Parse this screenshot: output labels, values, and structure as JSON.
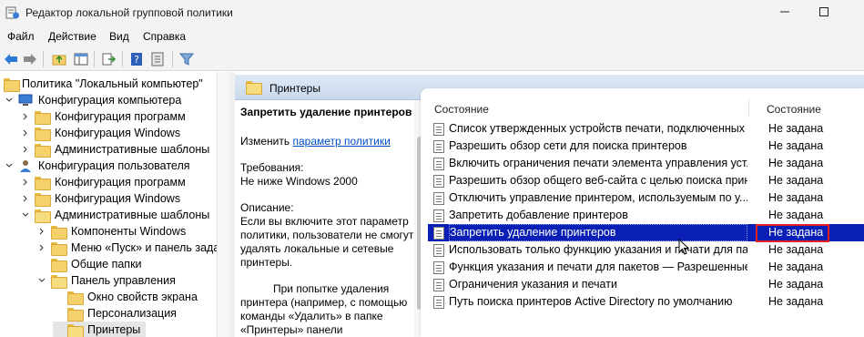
{
  "window": {
    "title": "Редактор локальной групповой политики"
  },
  "menu": [
    "Файл",
    "Действие",
    "Вид",
    "Справка"
  ],
  "toolbar": {
    "buttons": [
      "back-arrow-icon",
      "forward-arrow-icon",
      "up-folder-icon",
      "show-hide-tree-icon",
      "export-list-icon",
      "help-icon",
      "properties-icon",
      "filter-icon"
    ]
  },
  "tree": {
    "root": "Политика \"Локальный компьютер\"",
    "items": [
      {
        "label": "Конфигурация компьютера",
        "level": 1
      },
      {
        "label": "Конфигурация программ",
        "level": 2
      },
      {
        "label": "Конфигурация Windows",
        "level": 2
      },
      {
        "label": "Административные шаблоны",
        "level": 2
      },
      {
        "label": "Конфигурация пользователя",
        "level": 1
      },
      {
        "label": "Конфигурация программ",
        "level": 2
      },
      {
        "label": "Конфигурация Windows",
        "level": 2
      },
      {
        "label": "Административные шаблоны",
        "level": 2
      },
      {
        "label": "Компоненты Windows",
        "level": 3
      },
      {
        "label": "Меню «Пуск» и панель зада",
        "level": 3
      },
      {
        "label": "Общие папки",
        "level": 3
      },
      {
        "label": "Панель управления",
        "level": 3
      },
      {
        "label": "Окно свойств экрана",
        "level": 4
      },
      {
        "label": "Персонализация",
        "level": 4
      },
      {
        "label": "Принтеры",
        "level": 4
      }
    ]
  },
  "right_header": {
    "title": "Принтеры"
  },
  "description": {
    "title": "Запретить удаление принтеров",
    "edit_prefix": "Изменить ",
    "edit_link": "параметр политики",
    "requirements_label": "Требования:",
    "requirements_value": "Не ниже Windows 2000",
    "desc_label": "Описание:",
    "desc_p1": "Если вы включите этот параметр политики, пользователи не смогут удалять локальные и сетевые принтеры.",
    "desc_p2": "При попытке удаления принтера (например, с помощью команды «Удалить» в папке «Принтеры» панели"
  },
  "table": {
    "headers": {
      "name": "Состояние",
      "state": "Состояние"
    },
    "rows": [
      {
        "name": "Список утвержденных устройств печати, подключенных ...",
        "state": "Не задана"
      },
      {
        "name": "Разрешить обзор сети для поиска принтеров",
        "state": "Не задана"
      },
      {
        "name": "Включить ограничения печати элемента управления уст...",
        "state": "Не задана"
      },
      {
        "name": "Разрешить обзор общего веб-сайта с целью поиска прин...",
        "state": "Не задана"
      },
      {
        "name": "Отключить управление принтером, используемым по у...",
        "state": "Не задана"
      },
      {
        "name": "Запретить добавление принтеров",
        "state": "Не задана"
      },
      {
        "name": "Запретить удаление принтеров",
        "state": "Не задана",
        "selected": true
      },
      {
        "name": "Использовать только функцию указания и печати для па...",
        "state": "Не задана"
      },
      {
        "name": "Функция указания и печати для пакетов — Разрешенные ...",
        "state": "Не задана"
      },
      {
        "name": "Ограничения указания и печати",
        "state": "Не задана"
      },
      {
        "name": "Путь поиска принтеров Active Directory по умолчанию",
        "state": "Не задана"
      }
    ]
  },
  "colors": {
    "selection": "#0a1fb5",
    "highlight_box": "#e32020",
    "link": "#0050c8"
  }
}
